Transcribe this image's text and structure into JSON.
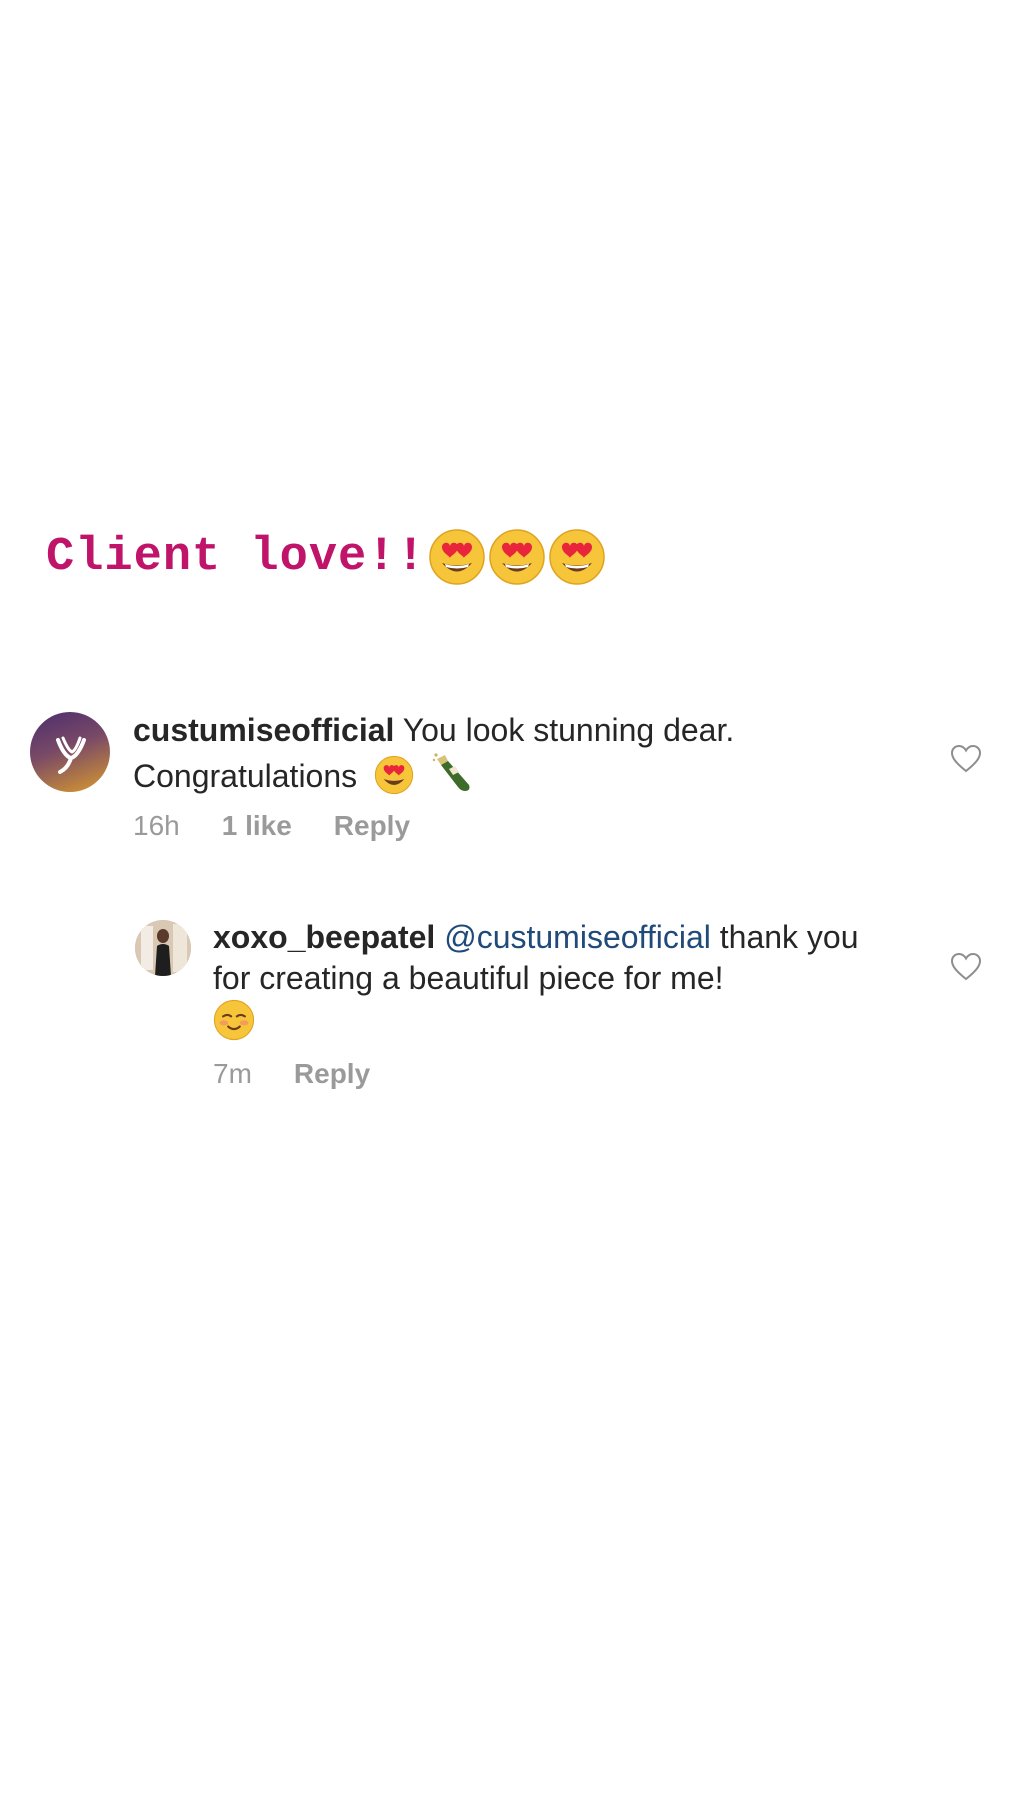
{
  "caption": {
    "text": "Client love!!",
    "emojis": [
      "heart-eyes-icon",
      "heart-eyes-icon",
      "heart-eyes-icon"
    ],
    "color": "#c0146b"
  },
  "comments": [
    {
      "username": "custumiseofficial",
      "text": "You look stunning dear. Congratulations",
      "emojis": [
        "heart-eyes-icon",
        "champagne-icon"
      ],
      "time": "16h",
      "likes": "1 like",
      "reply_label": "Reply",
      "avatar": "brand-logo-avatar"
    },
    {
      "username": "xoxo_beepatel",
      "mention": "@custumiseofficial",
      "text": "thank you for creating a beautiful piece for me!",
      "emojis": [
        "smiling-blush-icon"
      ],
      "time": "7m",
      "reply_label": "Reply",
      "avatar": "user-photo-avatar"
    }
  ],
  "colors": {
    "username": "#262626",
    "mention": "#1f4a7a",
    "meta": "#9a9a9a",
    "caption": "#c0146b"
  }
}
